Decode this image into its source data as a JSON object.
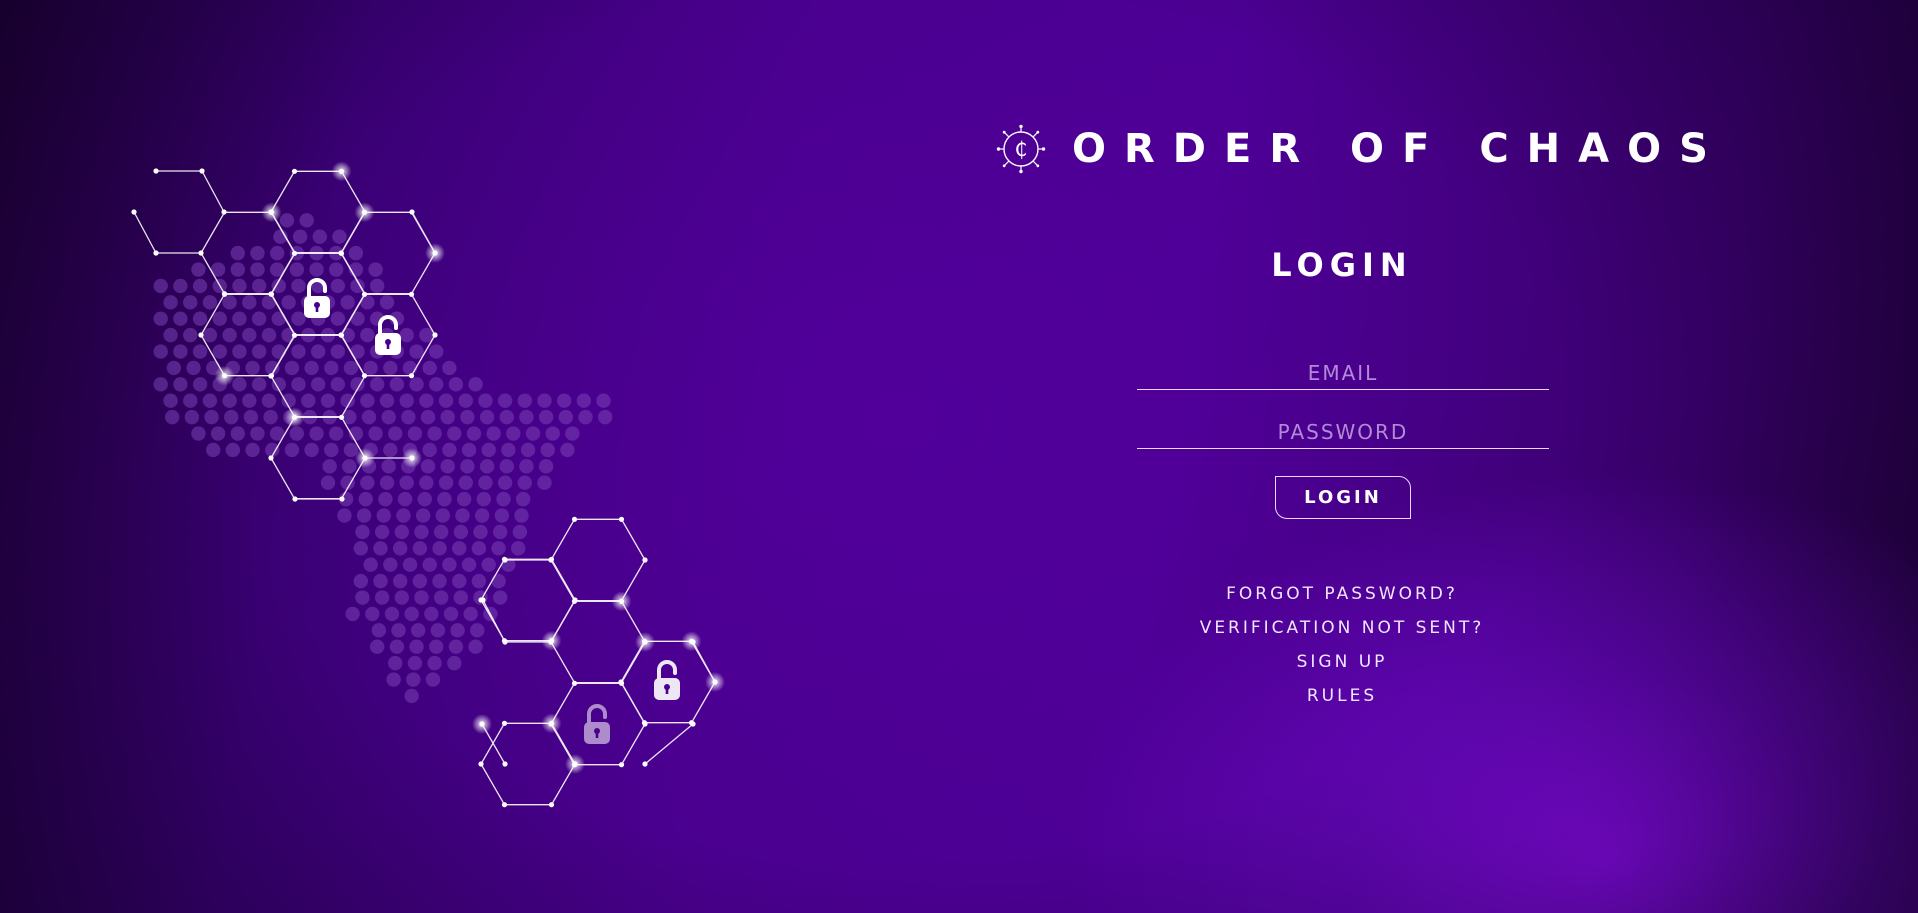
{
  "brand": {
    "name": "ORDER OF CHAOS",
    "logo_icon": "chaos-coin-icon",
    "logo_glyph": "₵"
  },
  "login": {
    "title": "LOGIN",
    "email_placeholder": "EMAIL",
    "password_placeholder": "PASSWORD",
    "submit_label": "LOGIN"
  },
  "links": {
    "forgot_password": "FORGOT PASSWORD?",
    "verification_not_sent": "VERIFICATION NOT SENT?",
    "sign_up": "SIGN UP",
    "rules": "RULES"
  },
  "illustration": {
    "icon": "hexagon-network-padlock-icon",
    "lock_icon": "unlocked-padlock-icon"
  },
  "colors": {
    "background_dark": "#2a0052",
    "background_mid": "#4a008f",
    "background_glow": "#8c0af0",
    "accent_line": "#e9d9ff",
    "dot_fill": "#7a3fb5",
    "placeholder": "#b28ad8"
  }
}
